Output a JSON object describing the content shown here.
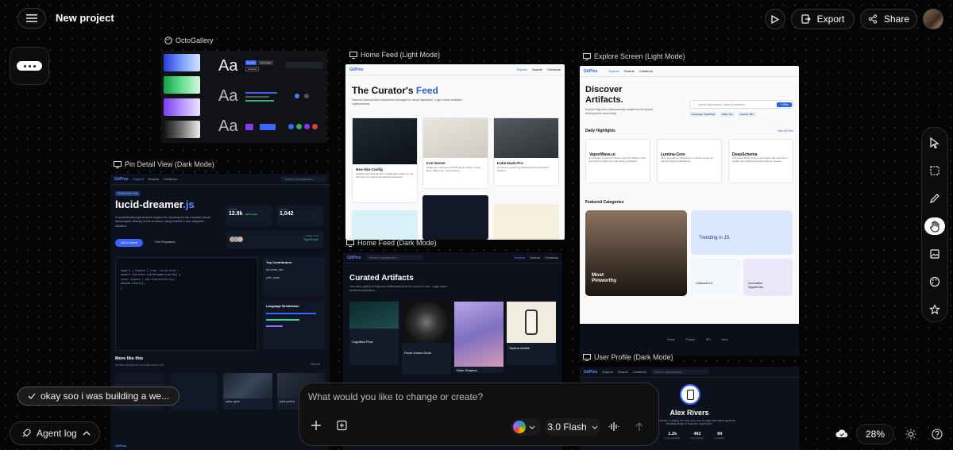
{
  "app": {
    "project_title": "New project",
    "export_label": "Export",
    "share_label": "Share",
    "zoom": "28%"
  },
  "boards": {
    "octogallery": {
      "label": "OctoGallery",
      "aa": "Aa",
      "chips": [
        "Primary",
        "Secondary",
        "Outlined"
      ]
    },
    "home_light": {
      "label": "Home Feed (Light Mode)",
      "brand": "GitPins",
      "nav": [
        "Explore",
        "Boards",
        "Creations"
      ],
      "heading": "The Curator's ",
      "heading_accent": "Feed",
      "subheading": "Discover hand-picked repositories arranged for visual inspiration. Logic meets aesthetic craftsmanship.",
      "cards": [
        {
          "title": "Neo-Vim-Config",
          "text": "A highly optimized NeoVim configuration written in Lua with focus on speed and beautiful aesthetics."
        },
        {
          "title": "Iron-Server",
          "text": "Scaling the Concurrent HTTP server written in pure Rust. Safety first, speed always."
        },
        {
          "title": "Kube-Dash-Pro",
          "text": "A real-time monitoring dashboard for Kubernetes clusters."
        }
      ]
    },
    "explore_light": {
      "label": "Explore Screen (Light Mode)",
      "brand": "GitPins",
      "nav": [
        "Explore",
        "Boards",
        "Creations"
      ],
      "heading_line1": "Discover",
      "heading_line2": "Artifacts.",
      "subheading": "Explore high-end craftsmanship curated by the global development community.",
      "search_placeholder": "Search repositories, topics or authors...",
      "filter_label": "+ Filter",
      "tags": [
        "Language: TypeScript",
        "Stars: 1k+",
        "License: MIT"
      ],
      "daily_title": "Daily Highlights",
      "view_all": "View All Pins",
      "highlights": [
        {
          "name": "VaporWave.ui",
          "text": "A nostalgic Component library built with Tailwind CSS and Framer Motion for high-fidelity aesthetics."
        },
        {
          "name": "Lumina-Core",
          "text": "Zero-dependency lightweight rendering engine for real-time data visualizations."
        },
        {
          "name": "DeepSchema",
          "text": "Advanced JSON schema generation that uses ML to predict new relationships and optimize queries."
        }
      ],
      "featured_title": "Featured Categories",
      "featured_big_line1": "Most",
      "featured_big_line2": "Pinworthy",
      "featured_trending": "Trending in JS",
      "featured_small": [
        "Cleanest UI",
        "Innovative Algorithms"
      ],
      "footer_links": [
        "Terms",
        "Privacy",
        "API",
        "Docs"
      ]
    },
    "pin_detail": {
      "label": "Pin Detail View (Dark Mode)",
      "brand": "GitPins",
      "nav": [
        "Explore",
        "Boards",
        "Creations"
      ],
      "search_placeholder": "Search repositories...",
      "badge": "FEATURED PIN",
      "title": "lucid-dreamer",
      "title_ext": ".js",
      "description": "A sophisticated generative engine for creating neural-inspired visual landscapes directly in the browser using WebGL2 and adaptive shaders.",
      "add_board": "Add to Board",
      "fork": "Fork Repository",
      "stars_label": "STARS",
      "stars": "12.8k",
      "stars_delta": "+12% today",
      "forks_label": "FORKS",
      "forks": "1,042",
      "language_label": "LANGUAGE",
      "language": "TypeScript",
      "code_lines": [
        "import { Engine } from 'lucid-core';",
        "export function initDreamer(config) {",
        "  const engine = new Engine(config);",
        "  engine.start();",
        "}"
      ],
      "contributors_title": "Top Contributors",
      "contributors": [
        "alt-runner_dev",
        "pixel_coder"
      ],
      "breakdown_title": "Language Breakdown",
      "more_title": "More like this",
      "more_sub": "Related repositories you might want to pin",
      "view_all": "View all",
      "related": [
        "cyber-synth",
        "pixel-perfect"
      ]
    },
    "home_dark": {
      "label": "Home Feed (Dark Mode)",
      "brand": "GitPins",
      "nav": [
        "Explore",
        "Boards",
        "Creations"
      ],
      "search_placeholder": "Search repositories...",
      "heading": "Curated Artifacts",
      "subheading": "Your daily gallery of high-end craftsmanship in the world of code. Logic meets aesthetic inspiration.",
      "cards": [
        "Cognitive-Flow",
        "Fenrir-Kernel-Hook",
        "Ether-Shaders",
        "Skyline-Mobile"
      ]
    },
    "profile_dark": {
      "label": "User Profile (Dark Mode)",
      "brand": "GitPins",
      "nav": [
        "Explore",
        "Boards",
        "Creations"
      ],
      "search_placeholder": "Search repositories...",
      "name": "Alex Rivers",
      "bio": "Architect & Aesthete. Curating the best open-source logic and visual systems. Building things in Rust and TypeScript.",
      "stats": [
        {
          "value": "1.2k",
          "label": "FOLLOWERS"
        },
        {
          "value": "482",
          "label": "FOLLOWING"
        },
        {
          "value": "84",
          "label": "BOARDS"
        }
      ]
    }
  },
  "prompt": {
    "placeholder": "What would you like to change or create?",
    "model": "3.0 Flash"
  },
  "agent": {
    "chip_text": "okay soo i was building a we...",
    "log_label": "Agent log"
  }
}
